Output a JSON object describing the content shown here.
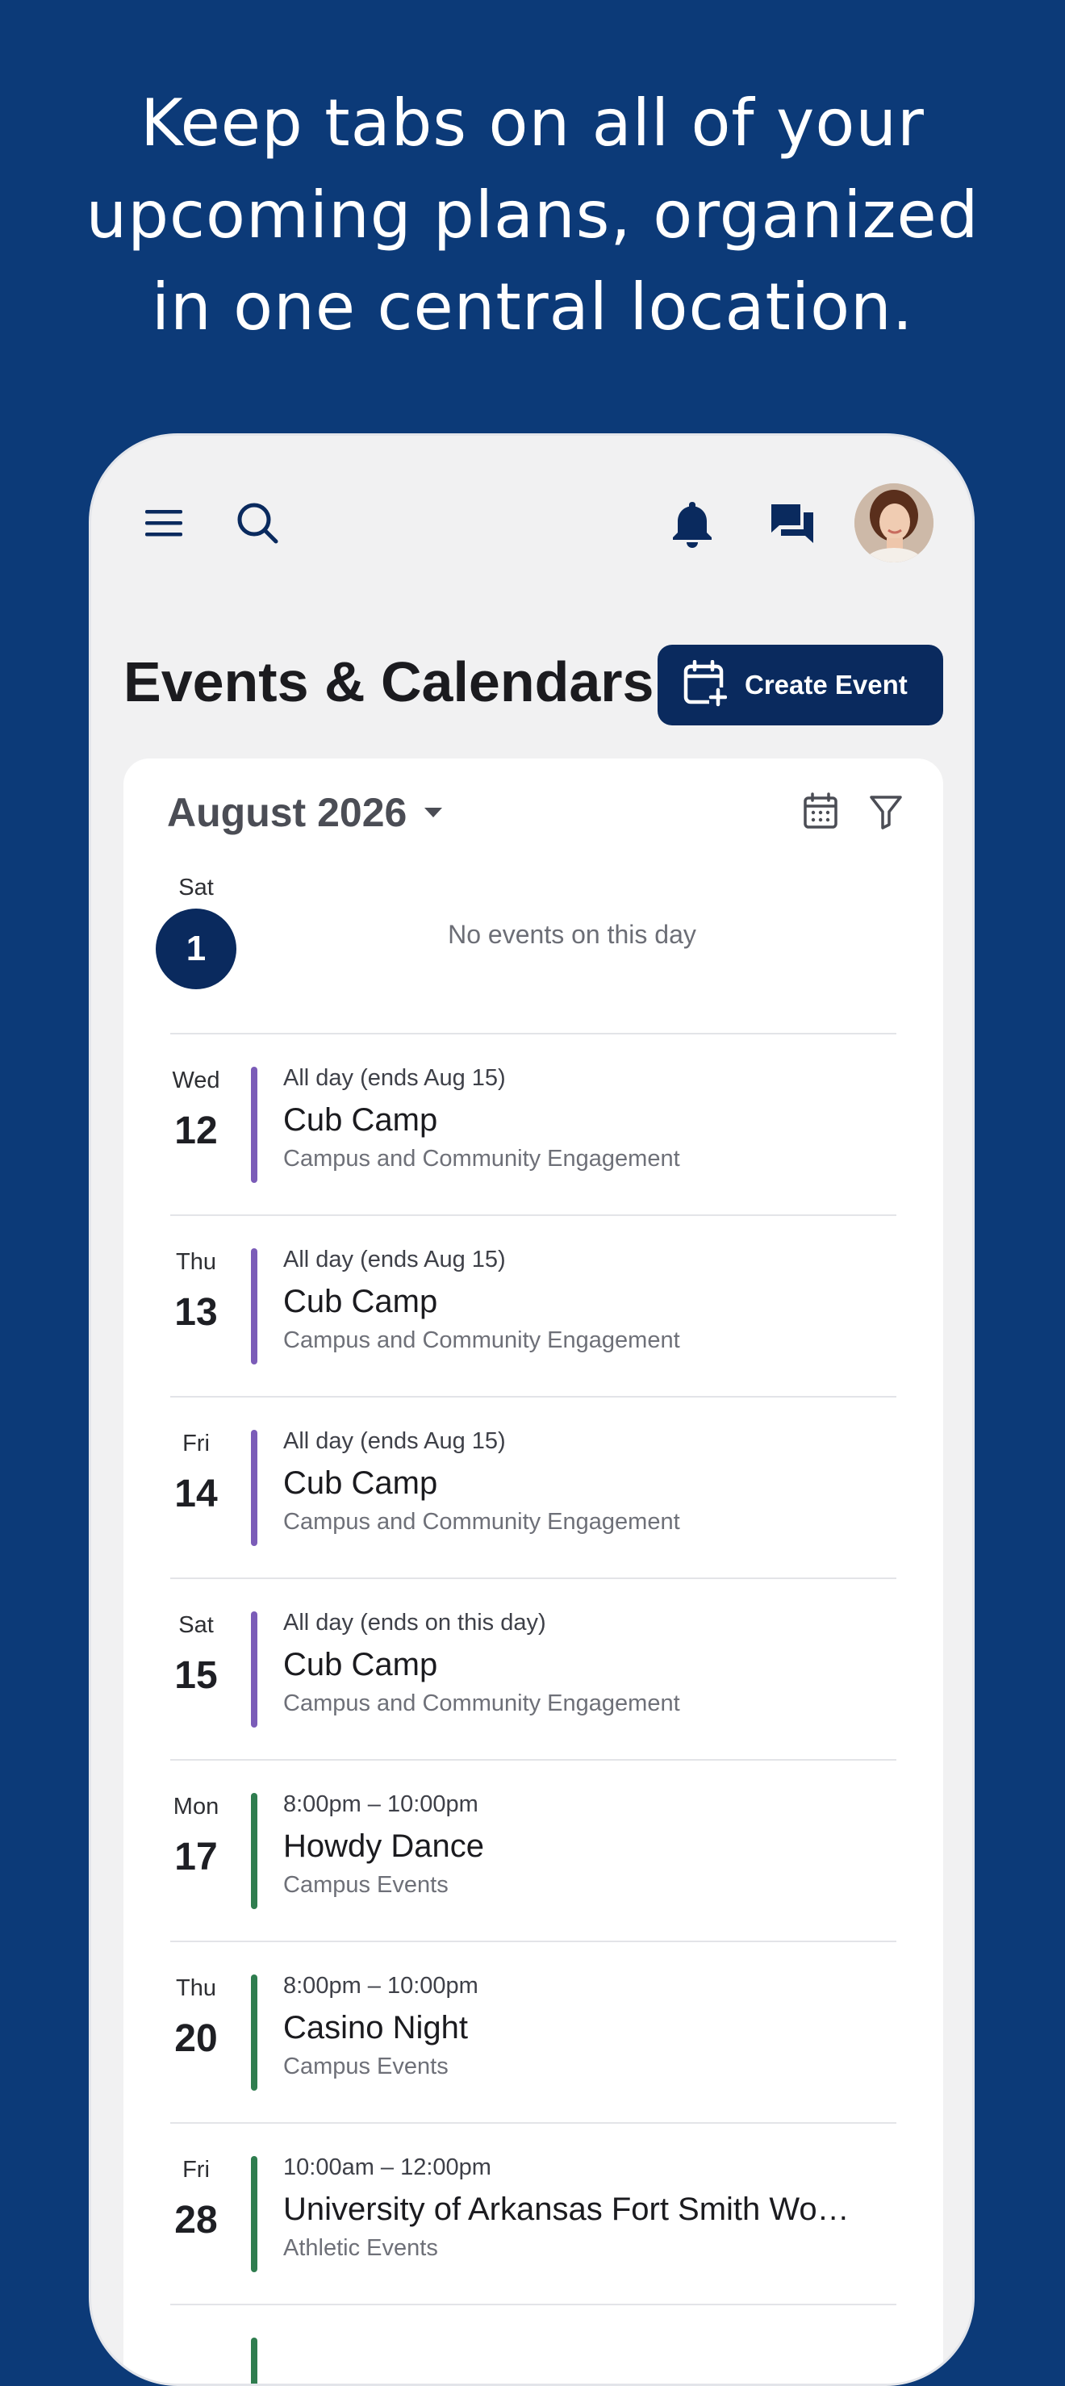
{
  "headline": [
    "Keep tabs on all of your",
    "upcoming plans, organized",
    "in one central location."
  ],
  "topbar": {
    "icons": [
      "menu-icon",
      "search-icon",
      "bell-icon",
      "messages-icon",
      "avatar"
    ]
  },
  "page": {
    "title": "Events & Calendars",
    "create_button": "Create Event"
  },
  "calendar": {
    "month_label": "August 2026",
    "selected_day": {
      "dow": "Sat",
      "day": "1"
    },
    "no_events_text": "No events on this day",
    "events": [
      {
        "dow": "Wed",
        "day": "12",
        "time": "All day (ends Aug 15)",
        "title": "Cub Camp",
        "calendar": "Campus and Community Engagement",
        "color": "#7b5cb8"
      },
      {
        "dow": "Thu",
        "day": "13",
        "time": "All day (ends Aug 15)",
        "title": "Cub Camp",
        "calendar": "Campus and Community Engagement",
        "color": "#7b5cb8"
      },
      {
        "dow": "Fri",
        "day": "14",
        "time": "All day (ends Aug 15)",
        "title": "Cub Camp",
        "calendar": "Campus and Community Engagement",
        "color": "#7b5cb8"
      },
      {
        "dow": "Sat",
        "day": "15",
        "time": "All day (ends on this day)",
        "title": "Cub Camp",
        "calendar": "Campus and Community Engagement",
        "color": "#7b5cb8"
      },
      {
        "dow": "Mon",
        "day": "17",
        "time": "8:00pm – 10:00pm",
        "title": "Howdy Dance",
        "calendar": "Campus Events",
        "color": "#2f7d4f"
      },
      {
        "dow": "Thu",
        "day": "20",
        "time": "8:00pm – 10:00pm",
        "title": "Casino Night",
        "calendar": "Campus Events",
        "color": "#2f7d4f"
      },
      {
        "dow": "Fri",
        "day": "28",
        "time": "10:00am – 12:00pm",
        "title": "University of Arkansas Fort Smith Wo…",
        "calendar": "Athletic Events",
        "color": "#2f7d4f"
      }
    ]
  },
  "colors": {
    "background": "#0c3a78",
    "primary": "#0a2a5e",
    "purple_calendar": "#7b5cb8",
    "green_calendar": "#2f7d4f"
  }
}
